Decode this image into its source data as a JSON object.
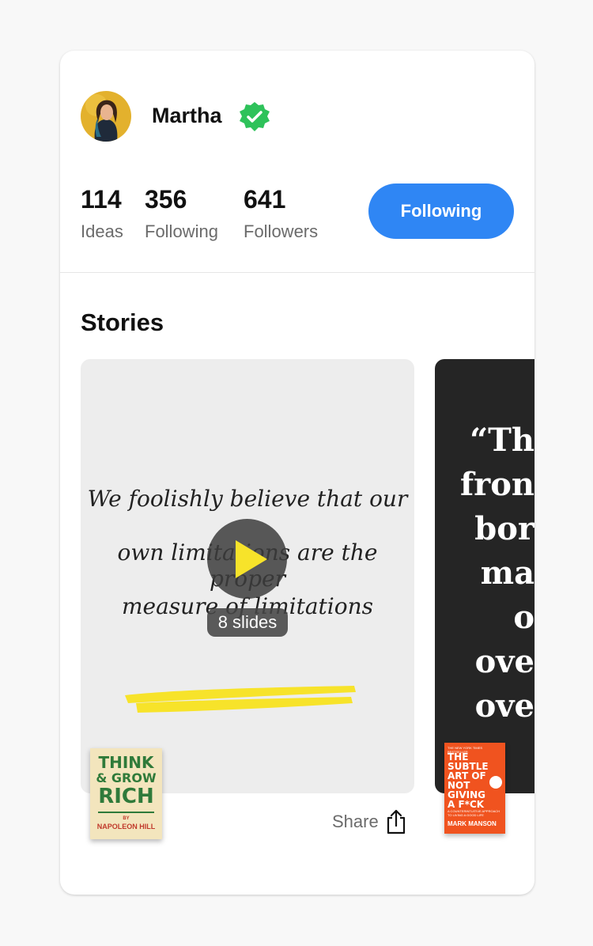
{
  "profile": {
    "name": "Martha",
    "verified": true,
    "stats": [
      {
        "value": "114",
        "label": "Ideas"
      },
      {
        "value": "356",
        "label": "Following"
      },
      {
        "value": "641",
        "label": "Followers"
      }
    ],
    "follow_button": "Following"
  },
  "stories": {
    "title": "Stories",
    "items": [
      {
        "quote_lines": [
          "We foolishly believe that our",
          "own limitations are the proper",
          "measure of limitations"
        ],
        "slides": "8 slides",
        "share_label": "Share",
        "book": {
          "title_line1": "THINK",
          "title_line2": "& GROW",
          "title_line3": "RICH",
          "by": "BY",
          "author": "NAPOLEON HILL"
        }
      },
      {
        "quote_lines": [
          "“Th",
          "fron",
          "bor",
          "ma",
          "o",
          "ove",
          "ove"
        ],
        "book": {
          "top_text": "THE NEW YORK TIMES BESTSELLER",
          "title_lines": [
            "THE",
            "SUBTLE",
            "ART OF",
            "NOT",
            "GIVING",
            "A F*CK"
          ],
          "subtitle": "A COUNTERINTUITIVE APPROACH TO LIVING A GOOD LIFE",
          "author": "MARK MANSON"
        }
      }
    ]
  },
  "colors": {
    "accent": "#2f86f4",
    "verified": "#2ec25a",
    "highlight": "#f7e32a"
  },
  "icons": [
    "verified-badge-icon",
    "play-icon",
    "share-icon"
  ]
}
